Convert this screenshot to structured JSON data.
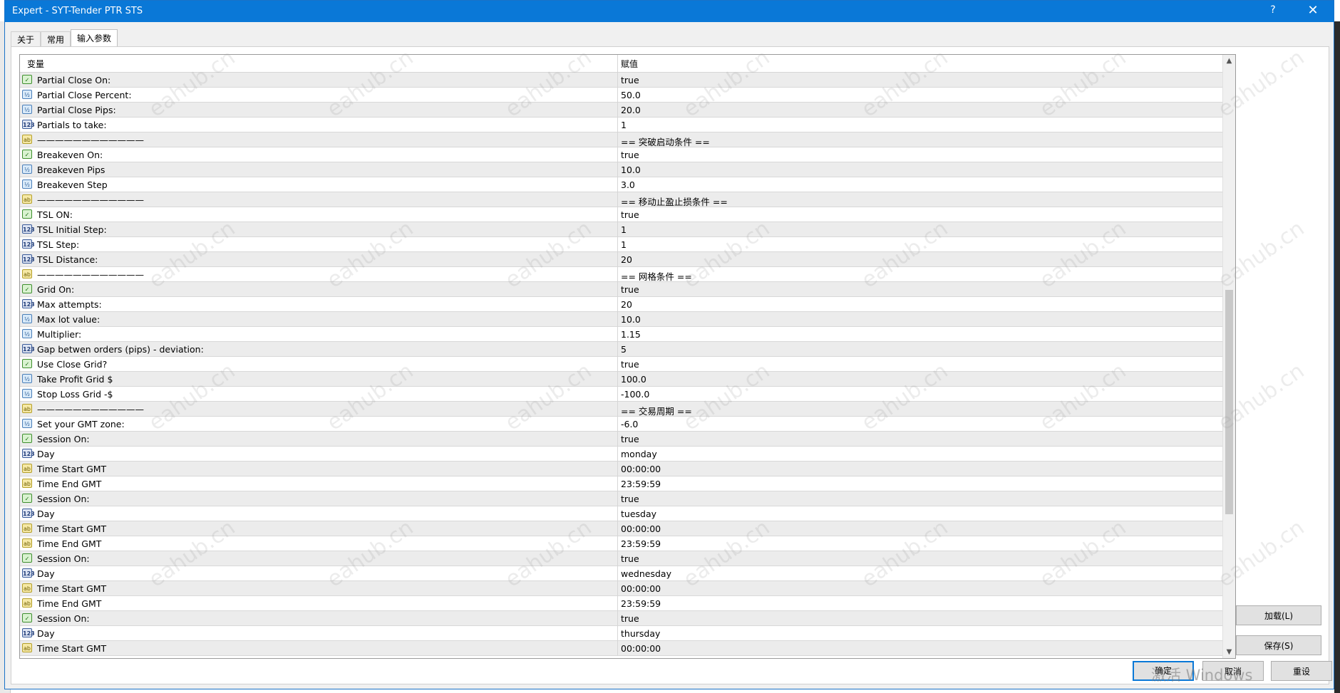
{
  "window": {
    "title": "Expert - SYT-Tender PTR STS",
    "help_label": "?",
    "close_label": "✕"
  },
  "tabs": [
    "关于",
    "常用",
    "输入参数"
  ],
  "active_tab": 2,
  "grid": {
    "header": {
      "variable": "变量",
      "value": "赋值"
    },
    "rows": [
      {
        "type": "bool",
        "name": "Partial Close On:",
        "value": "true"
      },
      {
        "type": "dbl",
        "name": "Partial Close Percent:",
        "value": "50.0"
      },
      {
        "type": "dbl",
        "name": "Partial Close Pips:",
        "value": "20.0"
      },
      {
        "type": "int",
        "name": "Partials to take:",
        "value": "1"
      },
      {
        "type": "str",
        "name": "————————————",
        "value": "== 突破启动条件 =="
      },
      {
        "type": "bool",
        "name": "Breakeven On:",
        "value": "true"
      },
      {
        "type": "dbl",
        "name": "Breakeven Pips",
        "value": "10.0"
      },
      {
        "type": "dbl",
        "name": "Breakeven Step",
        "value": "3.0"
      },
      {
        "type": "str",
        "name": "————————————",
        "value": "== 移动止盈止损条件 =="
      },
      {
        "type": "bool",
        "name": "TSL ON:",
        "value": "true"
      },
      {
        "type": "int",
        "name": "TSL Initial Step:",
        "value": "1"
      },
      {
        "type": "int",
        "name": "TSL Step:",
        "value": "1"
      },
      {
        "type": "int",
        "name": "TSL Distance:",
        "value": "20"
      },
      {
        "type": "str",
        "name": "————————————",
        "value": "== 网格条件 =="
      },
      {
        "type": "bool",
        "name": "Grid On:",
        "value": "true"
      },
      {
        "type": "int",
        "name": "Max attempts:",
        "value": "20"
      },
      {
        "type": "dbl",
        "name": "Max lot value:",
        "value": "10.0"
      },
      {
        "type": "dbl",
        "name": "Multiplier:",
        "value": "1.15"
      },
      {
        "type": "int",
        "name": "Gap betwen orders (pips) - deviation:",
        "value": "5"
      },
      {
        "type": "bool",
        "name": "Use Close Grid?",
        "value": "true"
      },
      {
        "type": "dbl",
        "name": "Take Profit Grid $",
        "value": "100.0"
      },
      {
        "type": "dbl",
        "name": "Stop Loss Grid -$",
        "value": "-100.0"
      },
      {
        "type": "str",
        "name": "————————————",
        "value": "== 交易周期  =="
      },
      {
        "type": "dbl",
        "name": "Set your GMT zone:",
        "value": "-6.0"
      },
      {
        "type": "bool",
        "name": "Session On:",
        "value": "true"
      },
      {
        "type": "int",
        "name": "Day",
        "value": "monday"
      },
      {
        "type": "str",
        "name": "Time Start GMT",
        "value": "00:00:00"
      },
      {
        "type": "str",
        "name": "Time End GMT",
        "value": "23:59:59"
      },
      {
        "type": "bool",
        "name": "Session On:",
        "value": "true"
      },
      {
        "type": "int",
        "name": "Day",
        "value": "tuesday"
      },
      {
        "type": "str",
        "name": "Time Start GMT",
        "value": "00:00:00"
      },
      {
        "type": "str",
        "name": "Time End GMT",
        "value": "23:59:59"
      },
      {
        "type": "bool",
        "name": "Session On:",
        "value": "true"
      },
      {
        "type": "int",
        "name": "Day",
        "value": "wednesday"
      },
      {
        "type": "str",
        "name": "Time Start GMT",
        "value": "00:00:00"
      },
      {
        "type": "str",
        "name": "Time End GMT",
        "value": "23:59:59"
      },
      {
        "type": "bool",
        "name": "Session On:",
        "value": "true"
      },
      {
        "type": "int",
        "name": "Day",
        "value": "thursday"
      },
      {
        "type": "str",
        "name": "Time Start GMT",
        "value": "00:00:00"
      }
    ]
  },
  "icon_glyphs": {
    "bool": "✓",
    "dbl": "½",
    "int": "123",
    "str": "ab"
  },
  "buttons": {
    "load": "加载(L)",
    "save": "保存(S)",
    "ok": "确定",
    "cancel": "取消",
    "reset": "重设"
  },
  "overlay": {
    "activation_text": "激活 Windows",
    "watermark": "eahub.cn"
  }
}
